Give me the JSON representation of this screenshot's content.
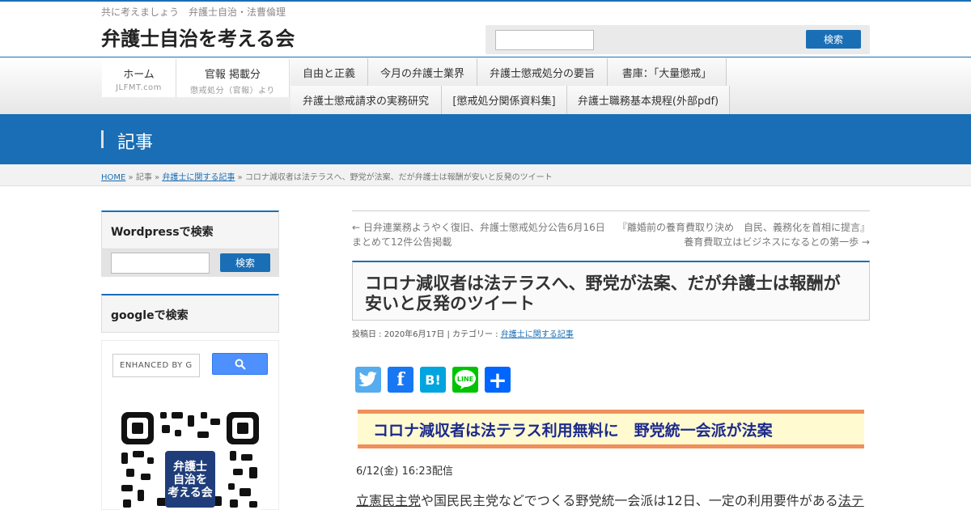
{
  "header": {
    "tagline": "共に考えましょう　弁護士自治・法曹倫理",
    "site_title": "弁護士自治を考える会",
    "search_button": "検索"
  },
  "nav": {
    "home": {
      "label": "ホーム",
      "sub": "JLFMT.com"
    },
    "kanpo": {
      "label": "官報 掲載分",
      "sub": "懲戒処分（官報）より"
    },
    "row1": [
      "自由と正義",
      "今月の弁護士業界",
      "弁護士懲戒処分の要旨",
      "書庫：「大量懲戒」"
    ],
    "row2": [
      "弁護士懲戒請求の実務研究",
      "[懲戒処分関係資料集]",
      "弁護士職務基本規程(外部pdf)"
    ]
  },
  "page_title": "記事",
  "breadcrumb": {
    "home": "HOME",
    "sep": "»",
    "articles": "記事",
    "category": "弁護士に関する記事",
    "current": "コロナ減収者は法テラスへ、野党が法案、だが弁護士は報酬が安いと反発のツイート"
  },
  "sidebar": {
    "wp_search_title": "Wordpressで検索",
    "wp_search_button": "検索",
    "google_search_title": "googleで検索",
    "google_placeholder": "ENHANCED BY G"
  },
  "post_nav": {
    "prev": "← 日弁連業務ようやく復旧、弁護士懲戒処分公告6月16日まとめて12件公告掲載",
    "next": "『離婚前の養育費取り決め　自民、義務化を首相に提言』養育費取立はビジネスになるとの第一歩 →"
  },
  "post": {
    "title": "コロナ減収者は法テラスへ、野党が法案、だが弁護士は報酬が安いと反発のツイート",
    "meta_prefix": "投稿日 : 2020年6月17日 | カテゴリー : ",
    "meta_category": "弁護士に関する記事",
    "headline": "コロナ減収者は法テラス利用無料に　野党統一会派が法案",
    "dateline": "6/12(金) 16:23配信",
    "body_link1": "立憲民主党",
    "body_text": "や国民民主党などでつくる野党統一会派は12日、一定の利用要件がある",
    "body_link2": "法テ"
  },
  "share": {
    "twitter_icon": "twitter-icon",
    "facebook_icon": "facebook-icon",
    "hatena_icon": "hatena-bookmark-icon",
    "line_icon": "line-icon",
    "add_icon": "share-plus-icon",
    "hatena_text": "B!",
    "facebook_text": "f",
    "add_text": "+"
  },
  "colors": {
    "accent": "#1a6eb5",
    "headline_border": "#f0905c",
    "headline_bg": "#fffad0",
    "headline_text": "#1c2a8c"
  }
}
